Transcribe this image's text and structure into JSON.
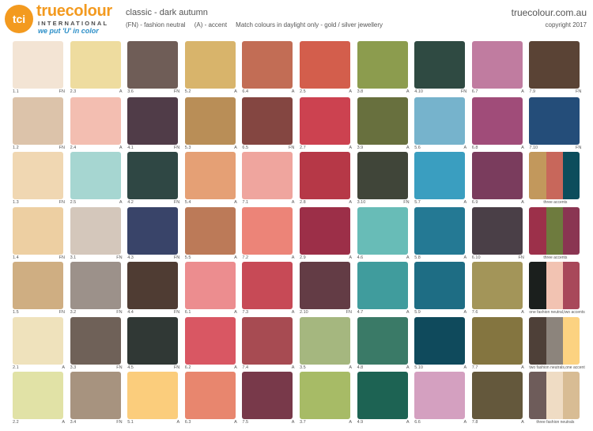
{
  "header": {
    "logo_badge": "tci",
    "brand_name": "truecolour",
    "brand_sub": "INTERNATIONAL",
    "brand_tagline": "we put 'U' in color",
    "palette_title": "classic - dark autumn",
    "legend": "(FN) - fashion neutral     (A) - accent     Match colours in daylight only - gold / silver jewellery",
    "site_url": "truecolour.com.au",
    "copyright": "copyright 2017"
  },
  "rows": [
    [
      {
        "code": "1.1",
        "type": "FN",
        "color": "#F3E4D4"
      },
      {
        "code": "2.3",
        "type": "A",
        "color": "#EEDC9F"
      },
      {
        "code": "3.6",
        "type": "FN",
        "color": "#6F5D57"
      },
      {
        "code": "5.2",
        "type": "A",
        "color": "#D8B46B"
      },
      {
        "code": "6.4",
        "type": "A",
        "color": "#C26D55"
      },
      {
        "code": "2.5",
        "type": "A",
        "color": "#D35E4C"
      },
      {
        "code": "3.8",
        "type": "A",
        "color": "#8C9C4E"
      },
      {
        "code": "4.10",
        "type": "FN",
        "color": "#2F4A42"
      },
      {
        "code": "6.7",
        "type": "A",
        "color": "#C07CA0"
      },
      {
        "code": "7.9",
        "type": "FN",
        "color": "#5A4335"
      }
    ],
    [
      {
        "code": "1.2",
        "type": "FN",
        "color": "#DCC3AA"
      },
      {
        "code": "2.4",
        "type": "A",
        "color": "#F3BEB1"
      },
      {
        "code": "4.1",
        "type": "FN",
        "color": "#503C48"
      },
      {
        "code": "5.3",
        "type": "A",
        "color": "#B98E57"
      },
      {
        "code": "6.5",
        "type": "FN",
        "color": "#844641"
      },
      {
        "code": "2.7",
        "type": "A",
        "color": "#CC4250"
      },
      {
        "code": "3.9",
        "type": "A",
        "color": "#68703E"
      },
      {
        "code": "5.6",
        "type": "A",
        "color": "#76B3CC"
      },
      {
        "code": "6.8",
        "type": "A",
        "color": "#A04C79"
      },
      {
        "code": "7.10",
        "type": "FN",
        "color": "#244D79"
      }
    ],
    [
      {
        "code": "1.3",
        "type": "FN",
        "color": "#F0D7B2"
      },
      {
        "code": "2.5",
        "type": "A",
        "color": "#A6D6D1"
      },
      {
        "code": "4.2",
        "type": "FN",
        "color": "#2F4744"
      },
      {
        "code": "5.4",
        "type": "A",
        "color": "#E5A075"
      },
      {
        "code": "7.1",
        "type": "A",
        "color": "#EFA59E"
      },
      {
        "code": "2.8",
        "type": "A",
        "color": "#B63847"
      },
      {
        "code": "3.10",
        "type": "FN",
        "color": "#404539"
      },
      {
        "code": "5.7",
        "type": "A",
        "color": "#3A9EC0"
      },
      {
        "code": "6.9",
        "type": "A",
        "color": "#7A3C5D"
      },
      {
        "type": "multi",
        "caption": "three accents",
        "colors": [
          "#C2985C",
          "#C8675B",
          "#0C4D5C"
        ]
      }
    ],
    [
      {
        "code": "1.4",
        "type": "FN",
        "color": "#EDCFA2"
      },
      {
        "code": "3.1",
        "type": "FN",
        "color": "#D4C7BB"
      },
      {
        "code": "4.3",
        "type": "FN",
        "color": "#394469"
      },
      {
        "code": "5.5",
        "type": "A",
        "color": "#BC7A58"
      },
      {
        "code": "7.2",
        "type": "A",
        "color": "#EC8478"
      },
      {
        "code": "2.9",
        "type": "A",
        "color": "#9C2F48"
      },
      {
        "code": "4.6",
        "type": "A",
        "color": "#68BCB7"
      },
      {
        "code": "5.8",
        "type": "A",
        "color": "#247994"
      },
      {
        "code": "6.10",
        "type": "FN",
        "color": "#4A3F47"
      },
      {
        "type": "multi",
        "caption": "three accents",
        "colors": [
          "#9C304A",
          "#6E7B3E",
          "#8A3552"
        ]
      }
    ],
    [
      {
        "code": "1.5",
        "type": "FN",
        "color": "#CFAE82"
      },
      {
        "code": "3.2",
        "type": "FN",
        "color": "#9C918A"
      },
      {
        "code": "4.4",
        "type": "FN",
        "color": "#4F3C33"
      },
      {
        "code": "6.1",
        "type": "A",
        "color": "#EC8D8F"
      },
      {
        "code": "7.3",
        "type": "A",
        "color": "#C74A56"
      },
      {
        "code": "2.10",
        "type": "FN",
        "color": "#633C45"
      },
      {
        "code": "4.7",
        "type": "A",
        "color": "#409C9D"
      },
      {
        "code": "5.9",
        "type": "A",
        "color": "#1E6D84"
      },
      {
        "code": "7.6",
        "type": "A",
        "color": "#A39559"
      },
      {
        "type": "multi",
        "caption": "one fashion neutral,two accents",
        "colors": [
          "#1B1F1D",
          "#F2C3B2",
          "#A8485A"
        ]
      }
    ],
    [
      {
        "code": "2.1",
        "type": "A",
        "color": "#EFE2BC"
      },
      {
        "code": "3.3",
        "type": "FN",
        "color": "#6F6158"
      },
      {
        "code": "4.5",
        "type": "FN",
        "color": "#303835"
      },
      {
        "code": "6.2",
        "type": "A",
        "color": "#D95763"
      },
      {
        "code": "7.4",
        "type": "A",
        "color": "#A74B52"
      },
      {
        "code": "3.5",
        "type": "A",
        "color": "#A5B77F"
      },
      {
        "code": "4.8",
        "type": "A",
        "color": "#3A7A67"
      },
      {
        "code": "5.10",
        "type": "A",
        "color": "#0F4A5C"
      },
      {
        "code": "7.7",
        "type": "A",
        "color": "#847540"
      },
      {
        "type": "multi",
        "caption": "two fashion neutrals,one accent",
        "colors": [
          "#4E4038",
          "#8C847C",
          "#FCD281"
        ]
      }
    ],
    [
      {
        "code": "2.2",
        "type": "A",
        "color": "#E1E2A6"
      },
      {
        "code": "3.4",
        "type": "FN",
        "color": "#A7937F"
      },
      {
        "code": "5.1",
        "type": "A",
        "color": "#FBCD7C"
      },
      {
        "code": "6.3",
        "type": "A",
        "color": "#E8866E"
      },
      {
        "code": "7.5",
        "type": "A",
        "color": "#78394A"
      },
      {
        "code": "3.7",
        "type": "A",
        "color": "#A7BB66"
      },
      {
        "code": "4.9",
        "type": "A",
        "color": "#1D6353"
      },
      {
        "code": "6.6",
        "type": "A",
        "color": "#D4A0C0"
      },
      {
        "code": "7.8",
        "type": "A",
        "color": "#64583C"
      },
      {
        "type": "multi",
        "caption": "three fashion neutrals",
        "colors": [
          "#6E5C5A",
          "#EFDCC4",
          "#D8BC94"
        ]
      }
    ]
  ]
}
